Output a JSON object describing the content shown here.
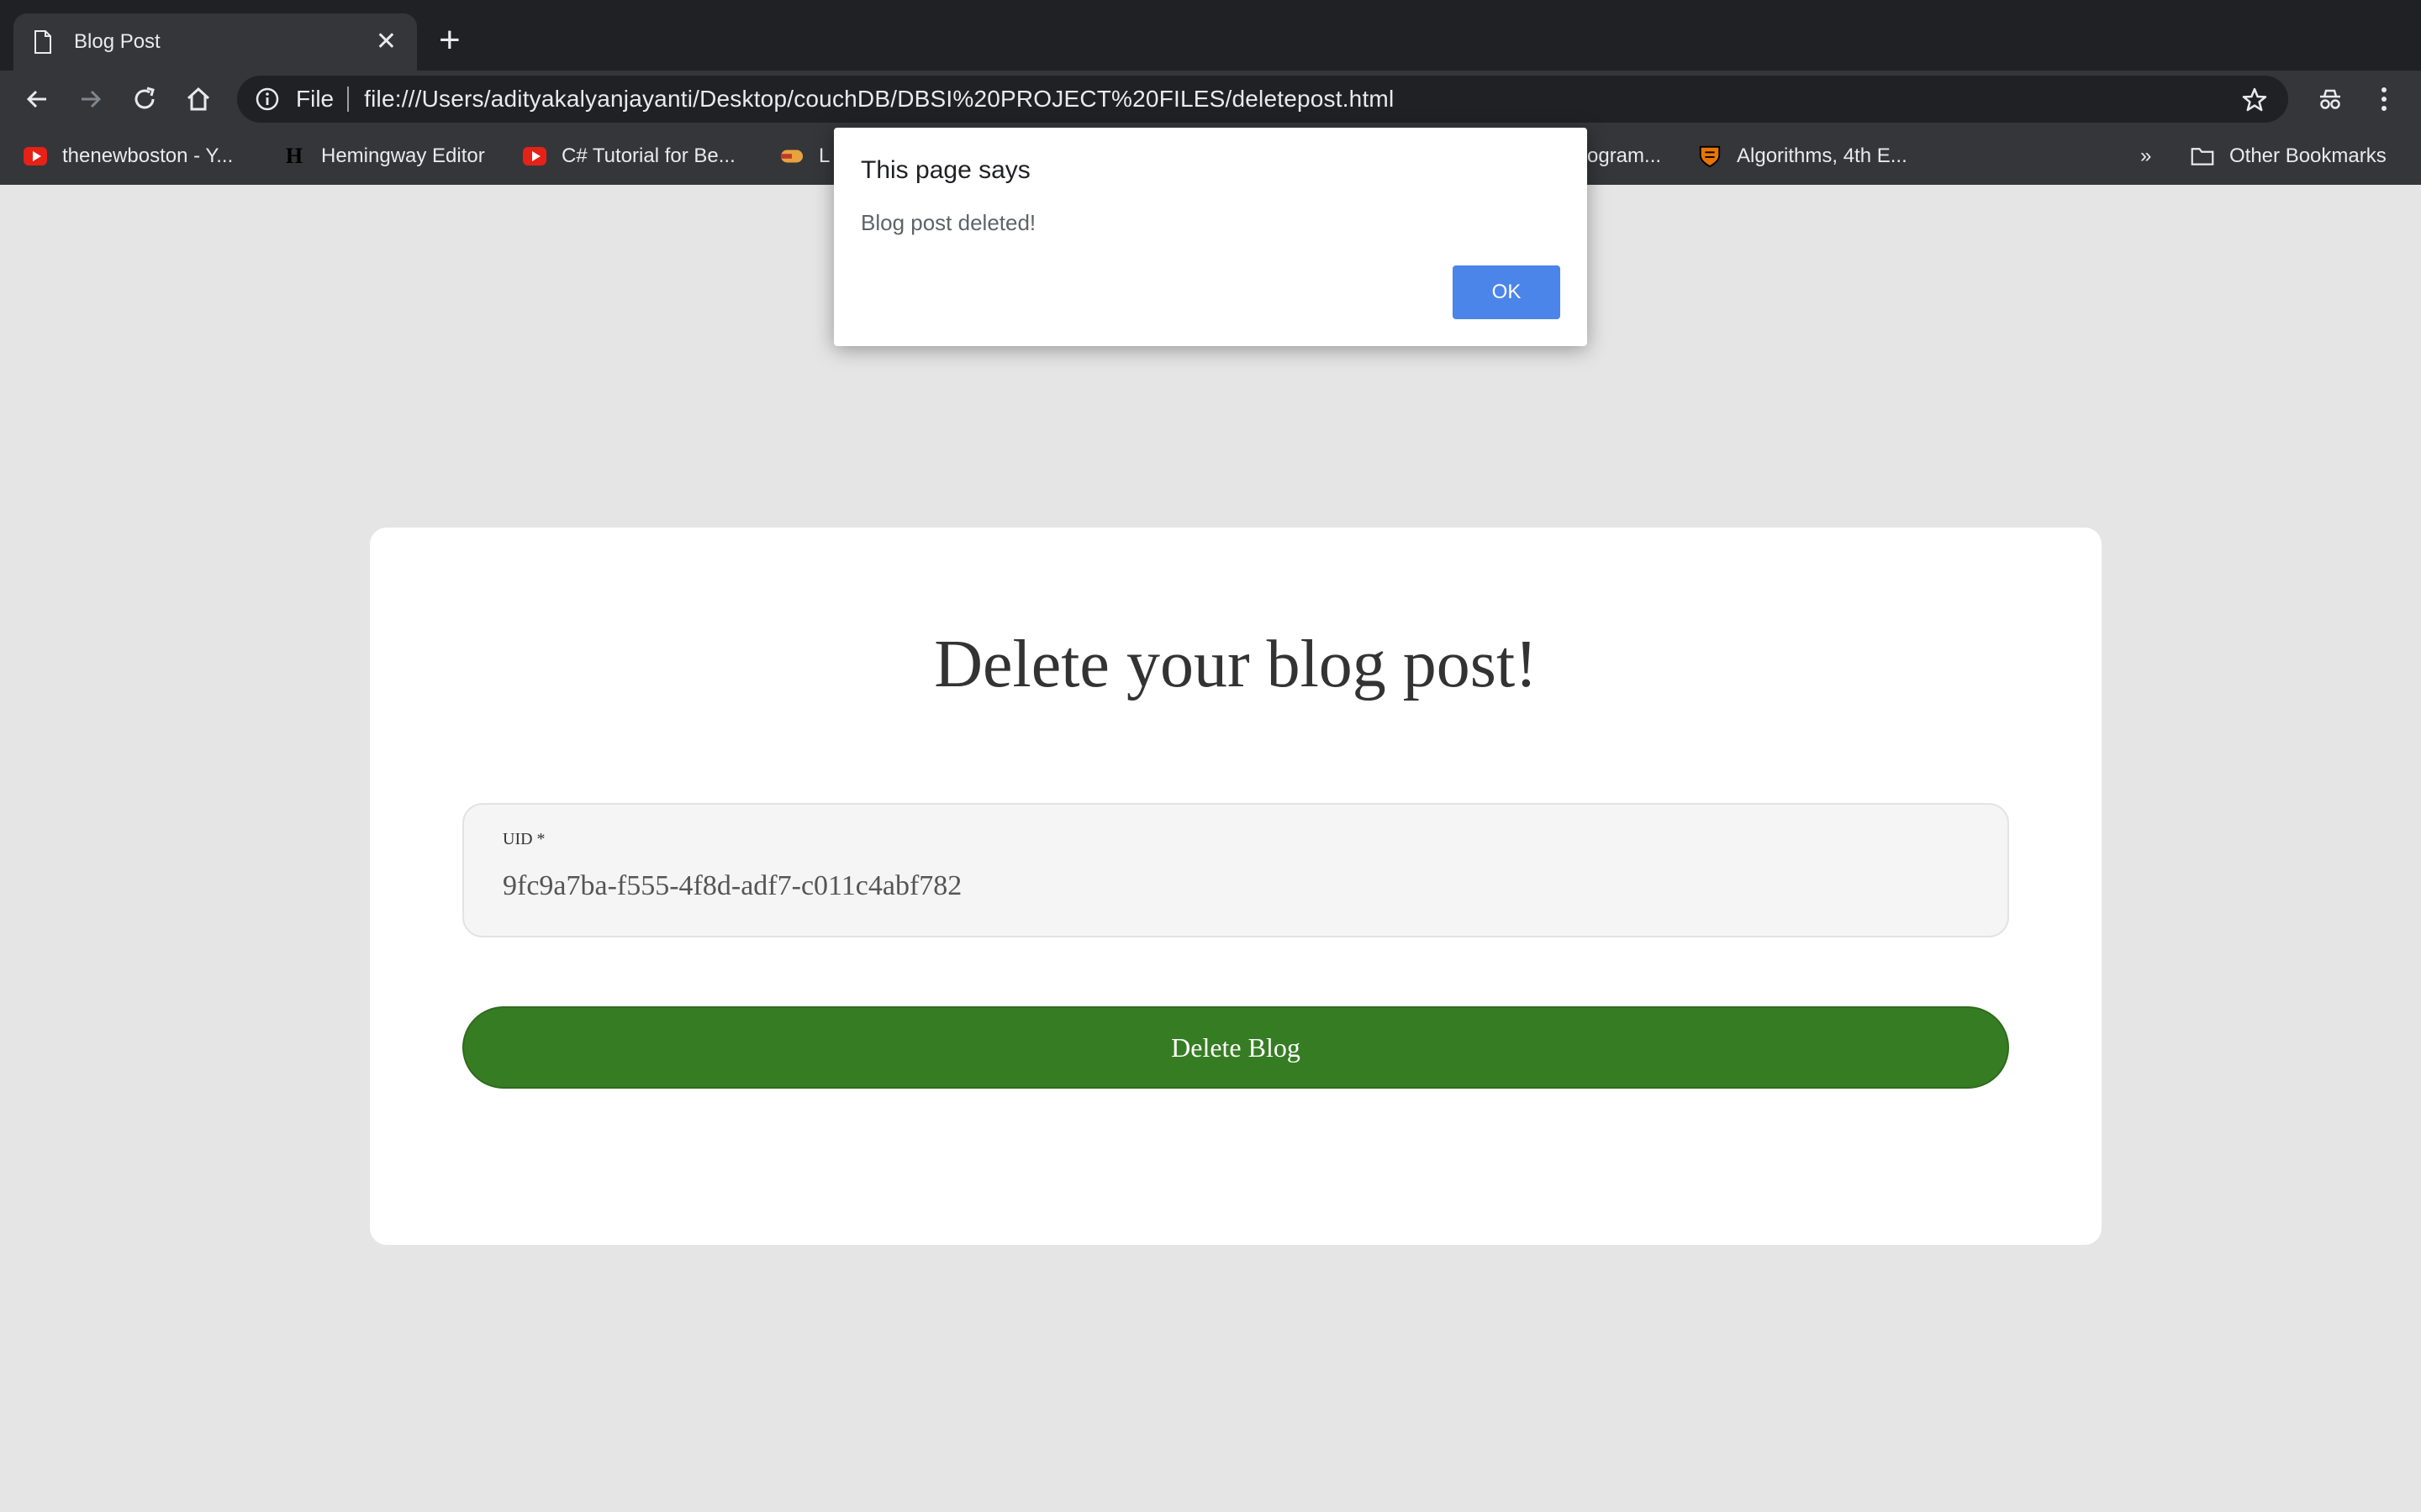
{
  "browser": {
    "tab_title": "Blog Post",
    "tab_close": "✕",
    "new_tab": "+",
    "omnibox": {
      "scheme": "File",
      "url": "file:///Users/adityakalyanjayanti/Desktop/couchDB/DBSI%20PROJECT%20FILES/deletepost.html"
    },
    "bookmarks": [
      {
        "label": "thenewboston - Y...",
        "icon": "youtube-icon"
      },
      {
        "label": "Hemingway Editor",
        "icon": "hemingway-icon"
      },
      {
        "label": "C# Tutorial for Be...",
        "icon": "youtube-icon"
      },
      {
        "label": "L",
        "icon": "bookmark-icon"
      },
      {
        "label": "rogram...",
        "icon": ""
      },
      {
        "label": "Algorithms, 4th E...",
        "icon": "princeton-icon"
      }
    ],
    "overflow": "»",
    "other_bookmarks": "Other Bookmarks",
    "hm_glyph": "H"
  },
  "page": {
    "title": "Delete your blog post!",
    "uid_label": "UID *",
    "uid_value": "9fc9a7ba-f555-4f8d-adf7-c011c4abf782",
    "delete_button": "Delete Blog"
  },
  "dialog": {
    "title": "This page says",
    "message": "Blog post deleted!",
    "ok": "OK"
  },
  "colors": {
    "accent_button": "#367c23",
    "dialog_ok": "#4c85ea",
    "page_background": "#e5e5e5"
  }
}
